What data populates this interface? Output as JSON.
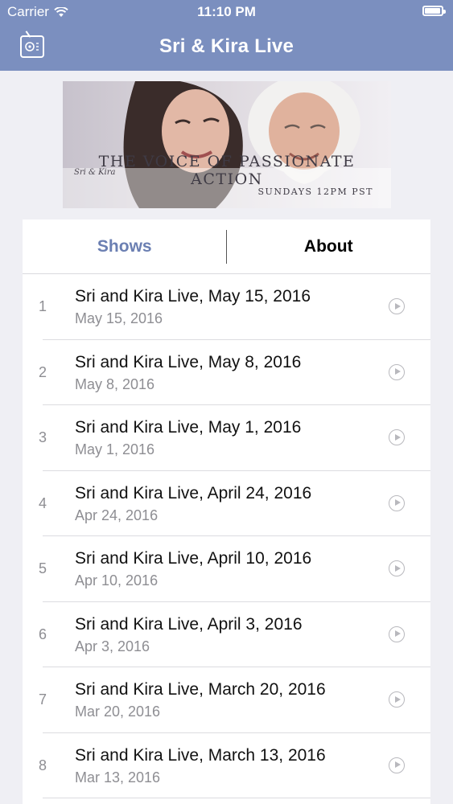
{
  "status": {
    "carrier": "Carrier",
    "time": "11:10 PM"
  },
  "nav": {
    "title": "Sri & Kira Live",
    "left_icon": "radio-icon"
  },
  "banner": {
    "signature": "Sri & Kira",
    "tagline": "THE VOICE OF PASSIONATE ACTION",
    "schedule": "SUNDAYS 12PM PST"
  },
  "tabs": [
    {
      "label": "Shows",
      "selected": true
    },
    {
      "label": "About",
      "selected": false
    }
  ],
  "episodes": [
    {
      "num": "1",
      "title": "Sri and Kira Live, May 15, 2016",
      "date": "May 15, 2016"
    },
    {
      "num": "2",
      "title": "Sri and Kira Live, May 8, 2016",
      "date": "May 8, 2016"
    },
    {
      "num": "3",
      "title": "Sri and Kira Live, May 1, 2016",
      "date": "May 1, 2016"
    },
    {
      "num": "4",
      "title": "Sri and Kira Live, April 24, 2016",
      "date": "Apr 24, 2016"
    },
    {
      "num": "5",
      "title": "Sri and Kira Live, April 10, 2016",
      "date": "Apr 10, 2016"
    },
    {
      "num": "6",
      "title": "Sri and Kira Live, April 3, 2016",
      "date": "Apr 3, 2016"
    },
    {
      "num": "7",
      "title": "Sri and Kira Live, March 20, 2016",
      "date": "Mar 20, 2016"
    },
    {
      "num": "8",
      "title": "Sri and Kira Live, March 13, 2016",
      "date": "Mar 13, 2016"
    }
  ],
  "colors": {
    "accent": "#7b8fbf",
    "tab_selected": "#6b7fb2",
    "background": "#efeff4"
  }
}
